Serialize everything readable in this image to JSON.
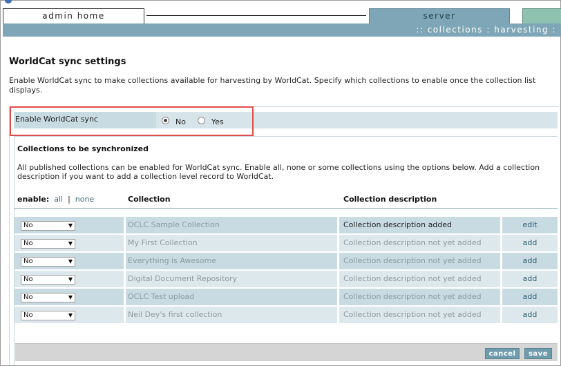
{
  "tabs": {
    "admin_home": "admin home",
    "server": "server"
  },
  "breadcrumb": {
    "prefix": "::",
    "collections": "collections",
    "separator": ":",
    "harvesting": "harvesting",
    "suffix": ":"
  },
  "page": {
    "title": "WorldCat sync settings",
    "intro": "Enable WorldCat sync to make collections available for harvesting by WorldCat. Specify which collections to enable once the collection list displays."
  },
  "sync": {
    "label": "Enable WorldCat sync",
    "option_no": "No",
    "option_yes": "Yes",
    "selected": "No"
  },
  "collections": {
    "title": "Collections to be synchronized",
    "description": "All published collections can be enabled for WorldCat sync. Enable all, none or some collections using the options below. Add a collection description if you want to add a collection level record to WorldCat.",
    "enable_label": "enable:",
    "enable_all": "all",
    "enable_sep": "|",
    "enable_none": "none",
    "col_collection": "Collection",
    "col_description": "Collection description",
    "rows": [
      {
        "select": "No",
        "name": "OCLC Sample Collection",
        "description": "Collection description added",
        "action": "edit"
      },
      {
        "select": "No",
        "name": "My First Collection",
        "description": "Collection description not yet added",
        "action": "add"
      },
      {
        "select": "No",
        "name": "Everything is Awesome",
        "description": "Collection description not yet added",
        "action": "add"
      },
      {
        "select": "No",
        "name": "Digital Document Repository",
        "description": "Collection description not yet added",
        "action": "add"
      },
      {
        "select": "No",
        "name": "OCLC Test upload",
        "description": "Collection description not yet added",
        "action": "add"
      },
      {
        "select": "No",
        "name": "Neil Dey's first collection",
        "description": "Collection description not yet added",
        "action": "add"
      }
    ]
  },
  "buttons": {
    "cancel": "cancel",
    "save": "save"
  },
  "colors": {
    "accent": "#7ea6b6",
    "highlight": "#e04a4a"
  }
}
